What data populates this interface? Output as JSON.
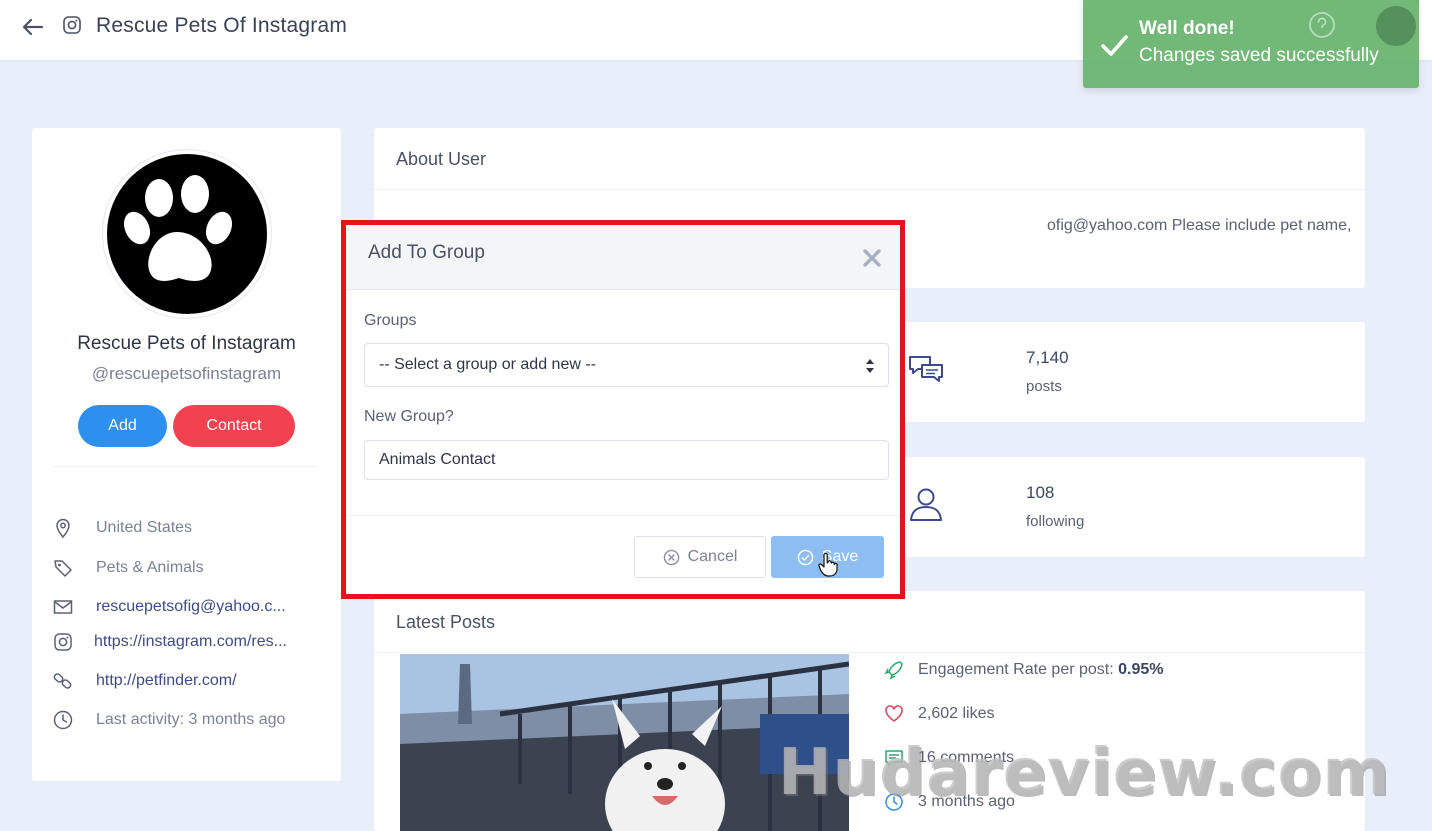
{
  "header": {
    "title": "Rescue Pets Of Instagram",
    "back_icon": "arrow-left-icon",
    "instagram_icon": "instagram-icon",
    "help_icon": "question-circle-icon"
  },
  "toast": {
    "title": "Well done!",
    "message": "Changes saved successfully",
    "color": "#66b36c"
  },
  "profile": {
    "name": "Rescue Pets of Instagram",
    "handle": "@rescuepetsofinstagram",
    "add_label": "Add",
    "contact_label": "Contact",
    "info": [
      {
        "icon": "map-pin-icon",
        "text": "United States"
      },
      {
        "icon": "tag-icon",
        "text": "Pets & Animals"
      },
      {
        "icon": "mail-icon",
        "text": "rescuepetsofig@yahoo.c..."
      },
      {
        "icon": "instagram-icon",
        "text": "https://instagram.com/res..."
      },
      {
        "icon": "link-icon",
        "text": "http://petfinder.com/"
      },
      {
        "icon": "clock-icon",
        "text": "Last activity: 3 months ago"
      }
    ]
  },
  "about": {
    "title": "About User",
    "text": "ofig@yahoo.com Please include pet name,"
  },
  "stats": [
    {
      "icon": "chat-bubbles-icon",
      "value": "7,140",
      "label": "posts"
    },
    {
      "icon": "user-icon",
      "value": "108",
      "label": "following"
    }
  ],
  "latest_posts": {
    "title": "Latest Posts",
    "metrics": [
      {
        "icon": "rocket-icon",
        "label": "Engagement Rate per post:",
        "value": "0.95%"
      },
      {
        "icon": "heart-icon",
        "label": "2,602 likes"
      },
      {
        "icon": "comment-icon",
        "label": "16 comments"
      },
      {
        "icon": "clock-icon",
        "label": "3 months ago"
      }
    ]
  },
  "modal": {
    "title": "Add To Group",
    "groups_label": "Groups",
    "select_value": "-- Select a group or add new --",
    "new_group_label": "New Group?",
    "new_group_value": "Animals Contact",
    "cancel_label": "Cancel",
    "save_label": "Save"
  },
  "watermark": "Hudareview.com",
  "colors": {
    "primary": "#2d8fee",
    "danger": "#f2414f",
    "highlight": "#e3141c",
    "save_button": "#8ebdf2"
  }
}
